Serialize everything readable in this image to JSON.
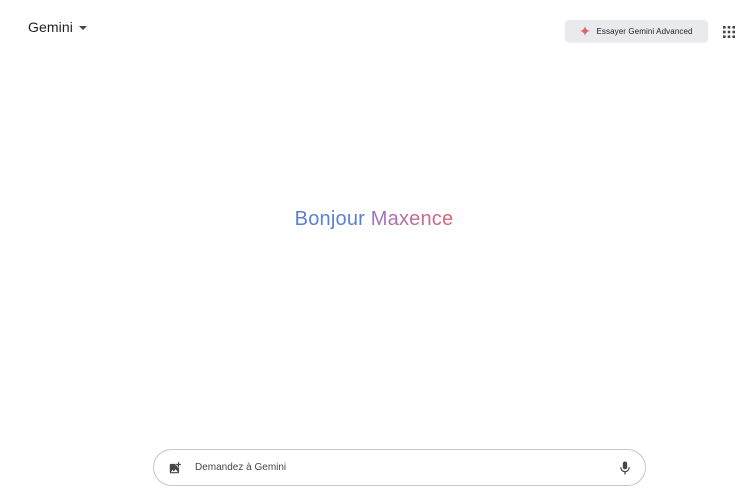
{
  "header": {
    "model_name": "Gemini",
    "model_caret_icon": "caret-down-icon",
    "advanced_button_label": "Essayer Gemini Advanced",
    "advanced_button_icon": "sparkle-icon",
    "apps_icon": "apps-grid-icon"
  },
  "greeting": {
    "hello": "Bonjour",
    "name": "Maxence"
  },
  "prompt": {
    "placeholder": "Demandez à Gemini",
    "value": "",
    "image_icon": "add-image-icon",
    "mic_icon": "microphone-icon"
  },
  "colors": {
    "greeting_hello": "#5b7fd8",
    "greeting_name_start": "#9b72cb",
    "greeting_name_end": "#d96570",
    "sparkle": "#d96570",
    "advanced_bg": "#e8eaed",
    "prompt_border": "#c4c7c5"
  }
}
